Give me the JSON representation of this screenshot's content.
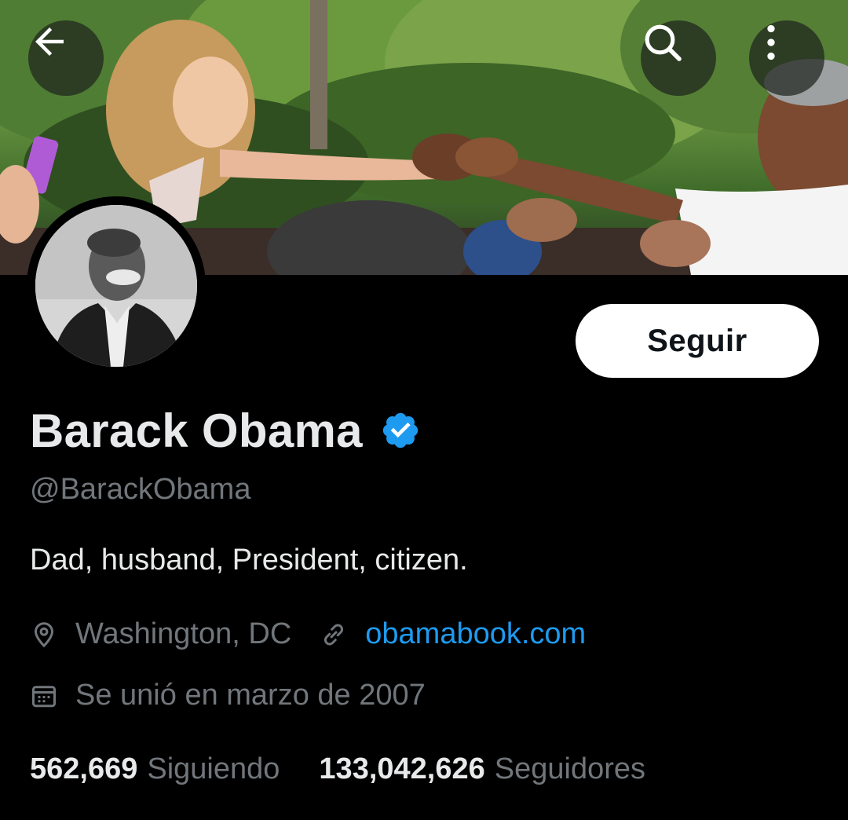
{
  "header": {
    "back_icon": "arrow-left-icon",
    "search_icon": "search-icon",
    "more_icon": "more-vertical-icon"
  },
  "profile": {
    "name": "Barack Obama",
    "verified": true,
    "handle": "@BarackObama",
    "bio": "Dad, husband, President, citizen.",
    "location": "Washington, DC",
    "website": "obamabook.com",
    "joined": "Se unió en marzo de 2007",
    "follow_label": "Seguir"
  },
  "stats": {
    "following_count": "562,669",
    "following_label": "Siguiendo",
    "followers_count": "133,042,626",
    "followers_label": "Seguidores"
  },
  "colors": {
    "background": "#000000",
    "text_primary": "#e7e9ea",
    "text_secondary": "#71767b",
    "link": "#1d9bf0",
    "verified_badge": "#1d9bf0"
  }
}
